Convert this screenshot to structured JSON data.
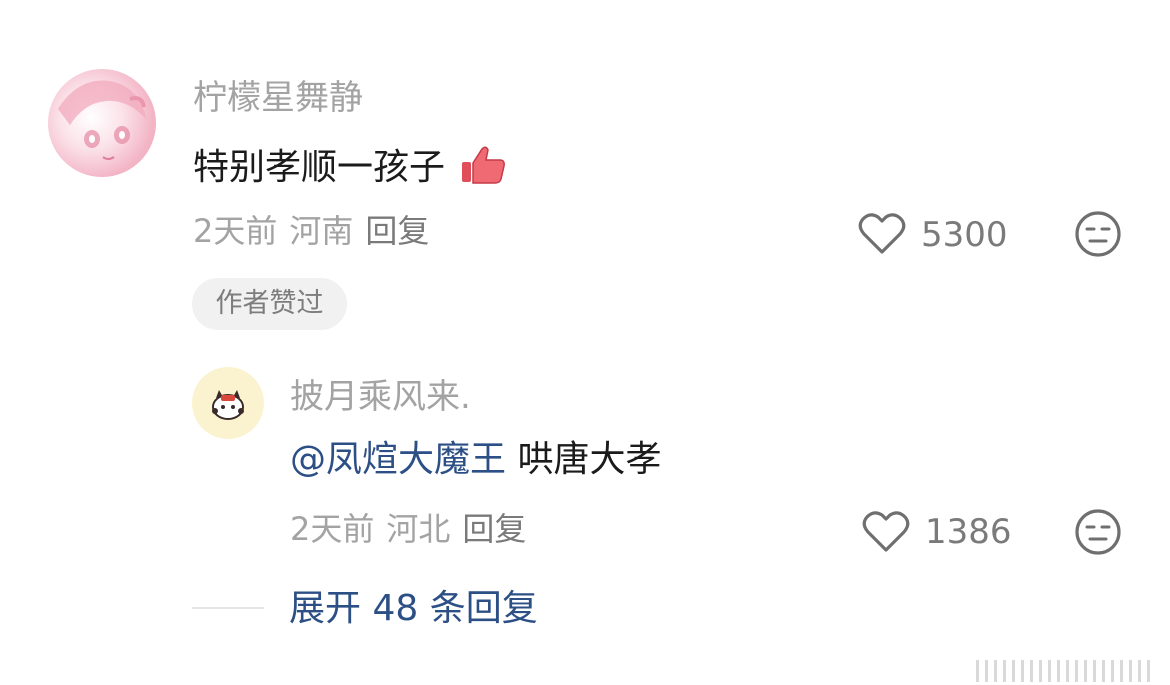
{
  "comment": {
    "username": "柠檬星舞静",
    "text": "特别孝顺一孩子",
    "emoji_icon": "thumbs-up-icon",
    "time": "2天前",
    "location": "河南",
    "reply_label": "回复",
    "likes": "5300",
    "badge": "作者赞过"
  },
  "reply": {
    "username": "披月乘风来.",
    "mention": "@凤煊大魔王",
    "text": "哄唐大孝",
    "time": "2天前",
    "location": "河北",
    "reply_label": "回复",
    "likes": "1386"
  },
  "expand_replies": {
    "label": "展开 48 条回复"
  },
  "colors": {
    "link_blue": "#2c4f85",
    "muted_gray": "#a3a3a3",
    "text_dark": "#1b1b1b",
    "badge_bg": "#f1f1f1"
  }
}
